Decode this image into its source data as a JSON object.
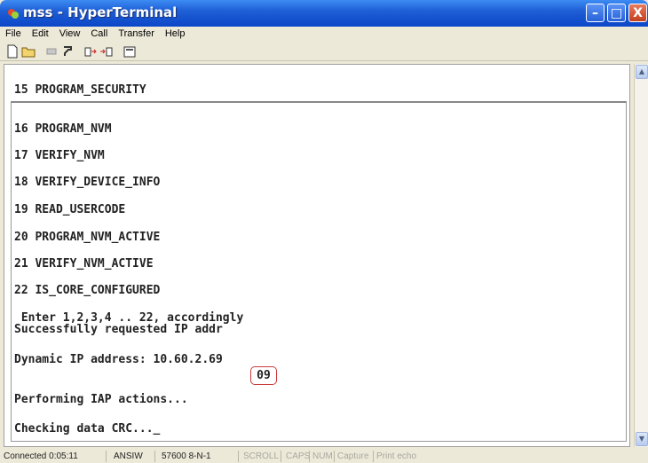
{
  "window": {
    "title": "mss - HyperTerminal",
    "min_symbol": "–",
    "max_symbol": "□",
    "close_symbol": "X"
  },
  "menu": [
    "File",
    "Edit",
    "View",
    "Call",
    "Transfer",
    "Help"
  ],
  "toolbar": [
    "new-icon",
    "open-icon",
    "disconnect-icon",
    "connect-icon",
    "send-icon",
    "receive-icon",
    "properties-icon"
  ],
  "terminal": {
    "header": "15 PROGRAM_SECURITY",
    "lines": [
      "16 PROGRAM_NVM",
      "17 VERIFY_NVM",
      "18 VERIFY_DEVICE_INFO",
      "19 READ_USERCODE",
      "20 PROGRAM_NVM_ACTIVE",
      "21 VERIFY_NVM_ACTIVE",
      "22 IS_CORE_CONFIGURED",
      " Enter 1,2,3,4 .. 22, accordingly",
      "Successfully requested IP addr",
      "Dynamic IP address: 10.60.2.69",
      "Performing IAP actions...",
      "Checking data CRC..._"
    ],
    "callout": "09"
  },
  "status": {
    "connected": "Connected 0:05:11",
    "emulation": "ANSIW",
    "port": "57600 8-N-1",
    "scroll": "SCROLL",
    "caps": "CAPS",
    "num": "NUM",
    "capture": "Capture",
    "print_echo": "Print echo"
  }
}
